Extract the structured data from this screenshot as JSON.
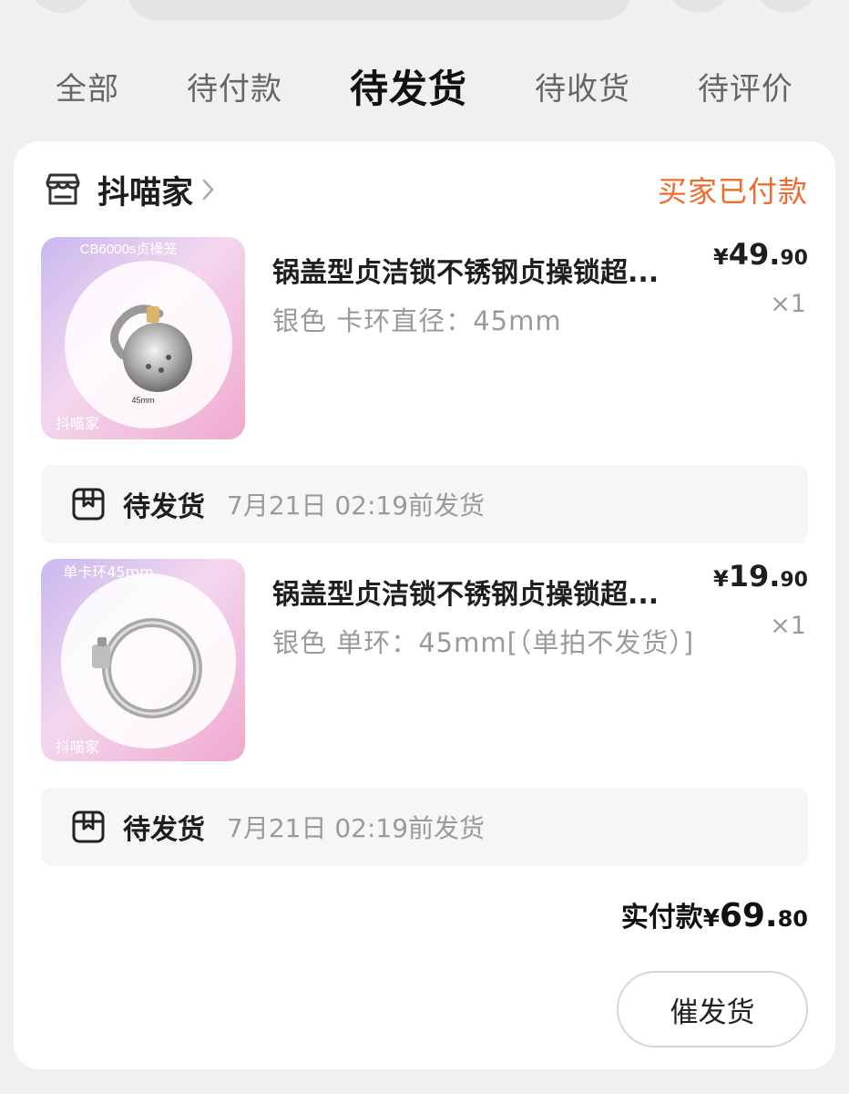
{
  "tabs": [
    {
      "label": "全部"
    },
    {
      "label": "待付款"
    },
    {
      "label": "待发货",
      "active": true
    },
    {
      "label": "待收货"
    },
    {
      "label": "待评价"
    }
  ],
  "order": {
    "shop_name": "抖喵家",
    "status": "买家已付款",
    "status_color": "#f06a2c",
    "items": [
      {
        "image_badge": "CB6000s贞操笼",
        "image_size_label": "45mm",
        "image_watermark": "抖喵家",
        "title": "锅盖型贞洁锁不锈钢贞操锁超...",
        "spec": "银色 卡环直径：45mm",
        "price_currency": "¥",
        "price_int": "49.",
        "price_dec": "90",
        "qty": "×1",
        "shipping_status": "待发货",
        "shipping_deadline": "7月21日 02:19前发货"
      },
      {
        "image_badge": "单卡环45mm",
        "image_watermark": "抖喵家",
        "title": "锅盖型贞洁锁不锈钢贞操锁超...",
        "spec": "银色 单环：45mm[（单拍不发货）]",
        "price_currency": "¥",
        "price_int": "19.",
        "price_dec": "90",
        "qty": "×1",
        "shipping_status": "待发货",
        "shipping_deadline": "7月21日 02:19前发货"
      }
    ],
    "total_label": "实付款",
    "total_currency": "¥",
    "total_int": "69.",
    "total_dec": "80",
    "action_button": "催发货"
  }
}
